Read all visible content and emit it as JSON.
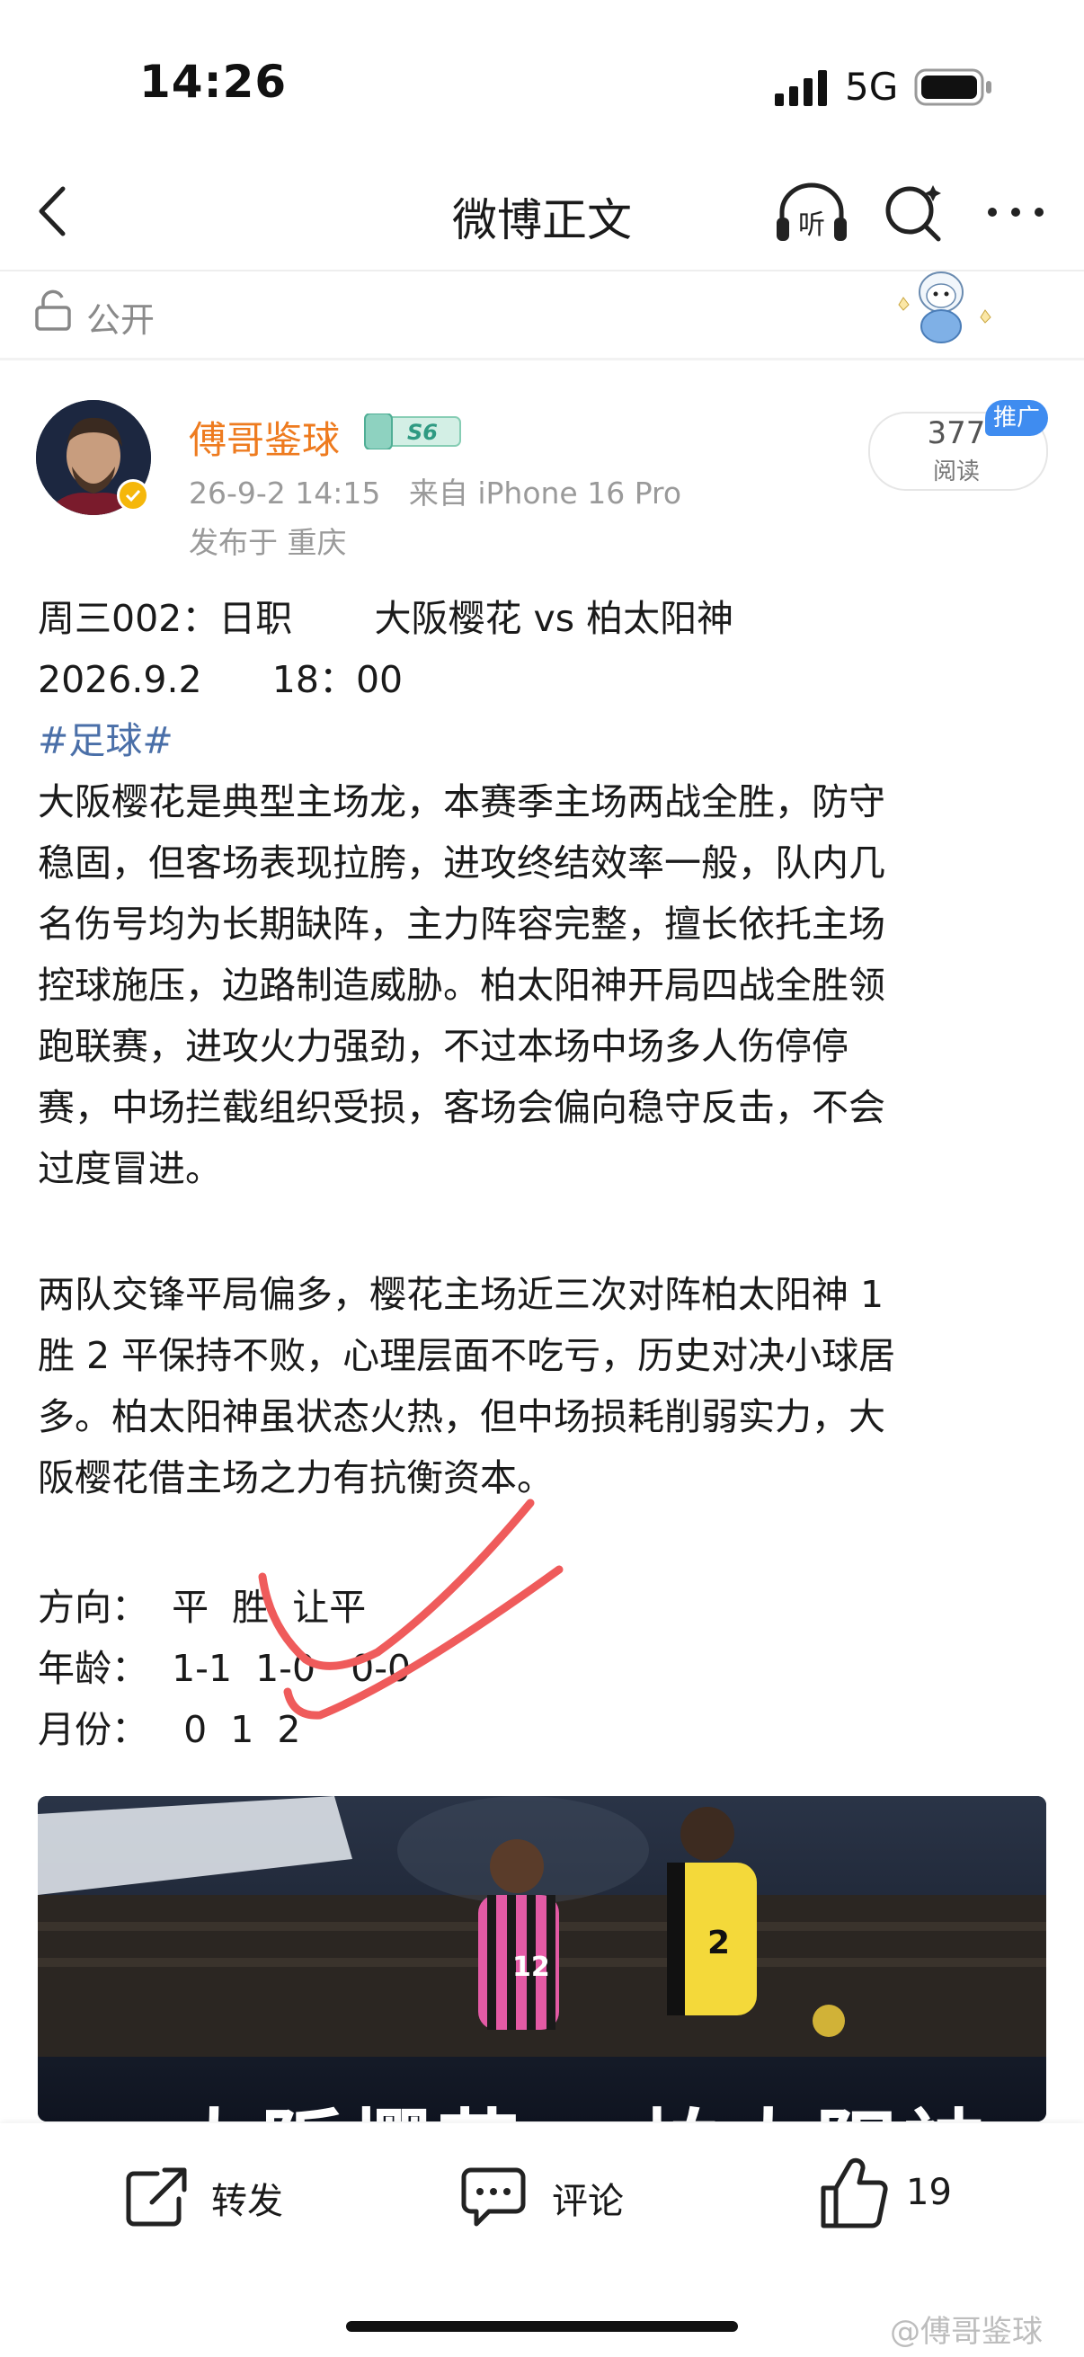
{
  "status_bar": {
    "time": "14:26",
    "network": "5G"
  },
  "nav": {
    "title": "微博正文",
    "listen_icon_label": "听"
  },
  "visibility": {
    "label": "公开"
  },
  "author": {
    "name": "傅哥鉴球",
    "level": "S6",
    "meta": "26-9-2 14:15   来自 iPhone 16 Pro",
    "location": "发布于 重庆"
  },
  "reads": {
    "count": "377",
    "label": "阅读",
    "promo": "推广"
  },
  "post": {
    "lines": [
      "周三002：日职       大阪樱花 vs 柏太阳神",
      "2026.9.2      18：00",
      "大阪樱花是典型主场龙，本赛季主场两战全胜，防守",
      "稳固，但客场表现拉胯，进攻终结效率一般，队内几",
      "名伤号均为长期缺阵，主力阵容完整，擅长依托主场",
      "控球施压，边路制造威胁。柏太阳神开局四战全胜领",
      "跑联赛，进攻火力强劲，不过本场中场多人伤停停",
      "赛，中场拦截组织受损，客场会偏向稳守反击，不会",
      "过度冒进。",
      "两队交锋平局偏多，樱花主场近三次对阵柏太阳神 1",
      "胜 2 平保持不败，心理层面不吃亏，历史对决小球居",
      "多。柏太阳神虽状态火热，但中场损耗削弱实力，大",
      "阪樱花借主场之力有抗衡资本。",
      "方向：  平  胜  让平",
      "年龄：  1-1  1-0   0-0",
      "月份：   0  1  2"
    ],
    "topic": "#足球#"
  },
  "image": {
    "overlay_text": "大阪樱花vs柏太阳神",
    "jersey_number_left": "12",
    "jersey_number_right": "2"
  },
  "actions": {
    "repost": "转发",
    "comment": "评论",
    "like_count": "19"
  },
  "watermark": "@傅哥鉴球",
  "colors": {
    "author": "#ee7b1f",
    "topic": "#4a6fa8",
    "promo": "#3f8cf0",
    "checkmark": "#ef5b5b"
  }
}
